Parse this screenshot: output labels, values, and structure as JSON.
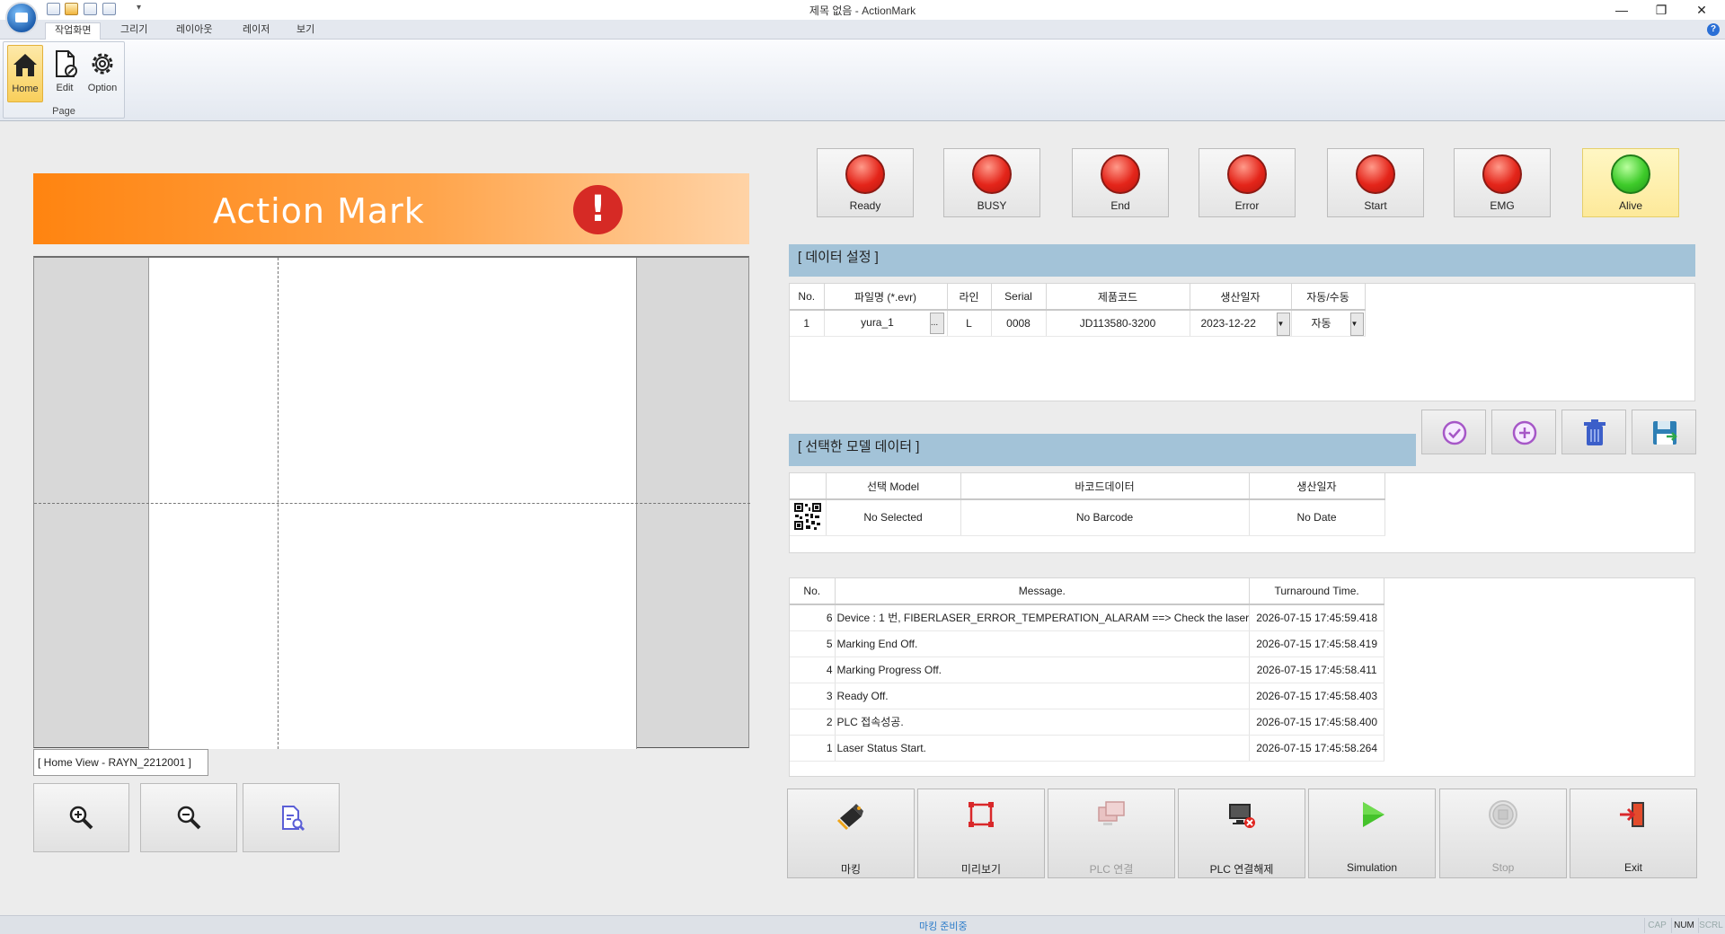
{
  "window": {
    "title": "제목 없음 - ActionMark",
    "minimize": "—",
    "restore": "❐",
    "close": "✕",
    "qat_more": "▾"
  },
  "ribbon": {
    "tabs": [
      "작업화면",
      "그리기",
      "레이아웃",
      "레이저",
      "보기"
    ],
    "active_tab": 0,
    "help": "?",
    "group_label": "Page",
    "buttons": [
      {
        "label": "Home",
        "icon": "home-icon"
      },
      {
        "label": "Edit",
        "icon": "edit-document-icon"
      },
      {
        "label": "Option",
        "icon": "gear-icon"
      }
    ]
  },
  "banner": {
    "title": "Action Mark",
    "alert": "!"
  },
  "canvas": {
    "home_view": "[  Home View - RAYN_2212001  ]"
  },
  "lamps": [
    {
      "label": "Ready",
      "state": "red"
    },
    {
      "label": "BUSY",
      "state": "red"
    },
    {
      "label": "End",
      "state": "red"
    },
    {
      "label": "Error",
      "state": "red"
    },
    {
      "label": "Start",
      "state": "red"
    },
    {
      "label": "EMG",
      "state": "red"
    },
    {
      "label": "Alive",
      "state": "green"
    }
  ],
  "data_settings": {
    "title": "[ 데이터 설정 ]",
    "headers": [
      "No.",
      "파일명 (*.evr)",
      "라인",
      "Serial",
      "제품코드",
      "생산일자",
      "자동/수동"
    ],
    "rows": [
      {
        "no": "1",
        "file": "yura_1",
        "browse": "...",
        "line": "L",
        "serial": "0008",
        "code": "JD113580-3200",
        "date": "2023-12-22",
        "mode": "자동"
      }
    ]
  },
  "selected_model": {
    "title": "[ 선택한 모델 데이터 ]",
    "headers": [
      "선택 Model",
      "바코드데이터",
      "생산일자"
    ],
    "row": {
      "model": "No Selected",
      "barcode": "No Barcode",
      "date": "No Date"
    }
  },
  "log": {
    "headers": [
      "No.",
      "Message.",
      "Turnaround Time."
    ],
    "rows": [
      {
        "no": "6",
        "message": "Device : 1 번,  FIBERLASER_ERROR_TEMPERATION_ALARAM ==> Check the laser",
        "time": "2026-07-15 17:45:59.418"
      },
      {
        "no": "5",
        "message": "Marking End Off.",
        "time": "2026-07-15 17:45:58.419"
      },
      {
        "no": "4",
        "message": "Marking Progress Off.",
        "time": "2026-07-15 17:45:58.411"
      },
      {
        "no": "3",
        "message": "Ready Off.",
        "time": "2026-07-15 17:45:58.403"
      },
      {
        "no": "2",
        "message": "PLC 접속성공.",
        "time": "2026-07-15 17:45:58.400"
      },
      {
        "no": "1",
        "message": "Laser Status Start.",
        "time": "2026-07-15 17:45:58.264"
      }
    ]
  },
  "actions": [
    {
      "label": "마킹",
      "enabled": true
    },
    {
      "label": "미리보기",
      "enabled": true
    },
    {
      "label": "PLC 연결",
      "enabled": false
    },
    {
      "label": "PLC 연결해제",
      "enabled": true
    },
    {
      "label": "Simulation",
      "enabled": true
    },
    {
      "label": "Stop",
      "enabled": false
    },
    {
      "label": "Exit",
      "enabled": true
    }
  ],
  "status_bar": {
    "text": "마킹 준비중",
    "indicators": [
      {
        "label": "CAP",
        "on": false
      },
      {
        "label": "NUM",
        "on": true
      },
      {
        "label": "SCRL",
        "on": false
      }
    ]
  },
  "colors": {
    "banner_orange": "#ff8410",
    "section_header": "#a3c3d8",
    "lamp_red": "#e4251a",
    "lamp_green": "#3ecb2a",
    "status_text": "#2b7bc9"
  }
}
